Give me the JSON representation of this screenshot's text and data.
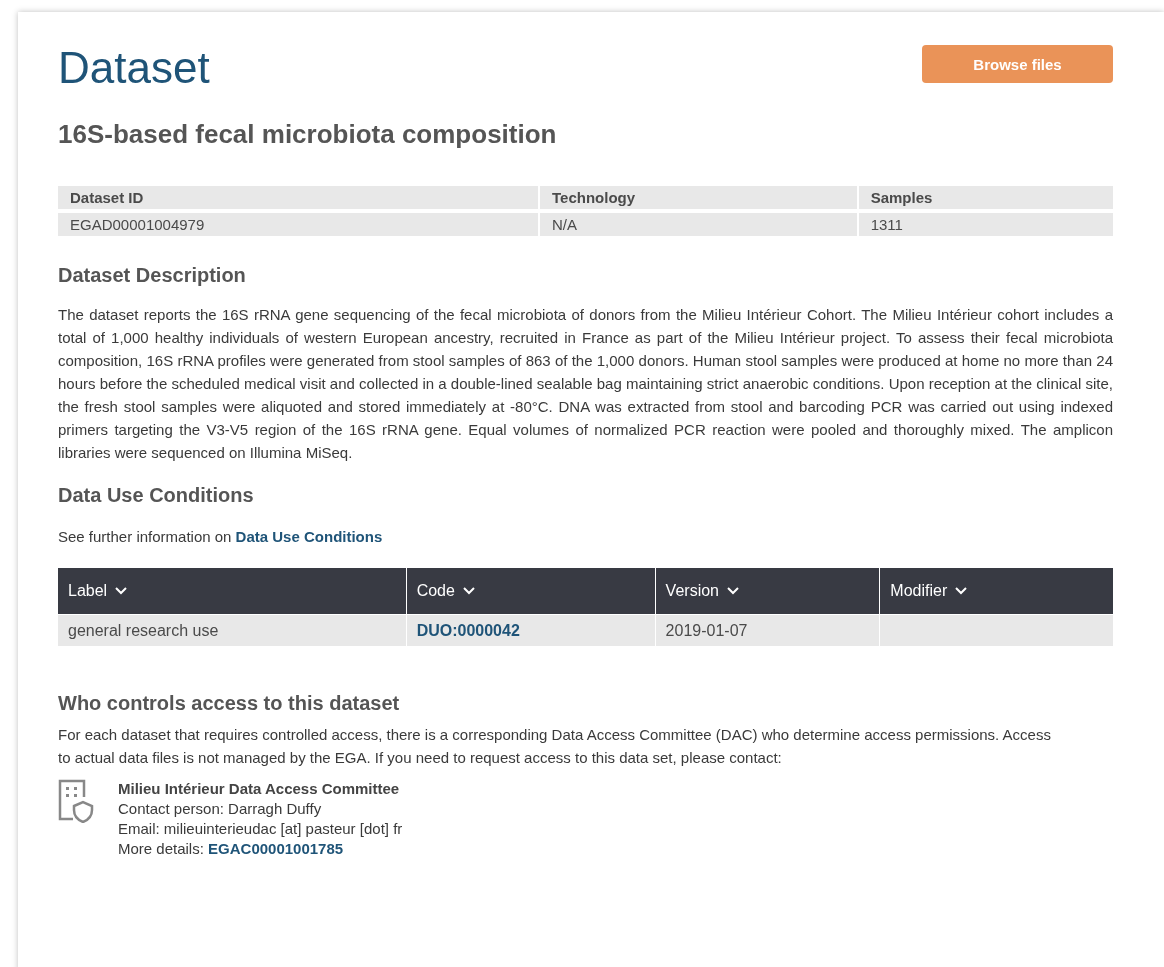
{
  "page_title": "Dataset",
  "browse_button": "Browse files",
  "dataset_title": "16S-based fecal microbiota composition",
  "summary_table": {
    "columns": [
      "Dataset ID",
      "Technology",
      "Samples"
    ],
    "rows": [
      [
        "EGAD00001004979",
        "N/A",
        "1311"
      ]
    ]
  },
  "description": {
    "heading": "Dataset Description",
    "text": "The dataset reports the 16S rRNA gene sequencing of the fecal microbiota of donors from the Milieu Intérieur Cohort. The Milieu Intérieur cohort includes a total of 1,000 healthy individuals of western European ancestry, recruited in France as part of the Milieu Intérieur project. To assess their fecal microbiota composition, 16S rRNA profiles were generated from stool samples of 863 of the 1,000 donors. Human stool samples were produced at home no more than 24 hours before the scheduled medical visit and collected in a double-lined sealable bag maintaining strict anaerobic conditions. Upon reception at the clinical site, the fresh stool samples were aliquoted and stored immediately at -80°C. DNA was extracted from stool and barcoding PCR was carried out using indexed primers targeting the V3-V5 region of the 16S rRNA gene. Equal volumes of normalized PCR reaction were pooled and thoroughly mixed. The amplicon libraries were sequenced on Illumina MiSeq."
  },
  "conditions": {
    "heading": "Data Use Conditions",
    "intro": "See further information on ",
    "intro_link": "Data Use Conditions",
    "columns": [
      "Label",
      "Code",
      "Version",
      "Modifier"
    ],
    "rows": [
      {
        "label": "general research use",
        "code": "DUO:0000042",
        "version": "2019-01-07"
      }
    ]
  },
  "access": {
    "heading": "Who controls access to this dataset",
    "text": "For each dataset that requires controlled access, there is a corresponding Data Access Committee (DAC) who determine access permissions. Access to actual data files is not managed by the EGA. If you need to request access to this data set, please contact:",
    "committee": "Milieu Intérieur Data Access Committee",
    "contact": "Contact person: Darragh Duffy",
    "email": "Email: milieuinterieudac [at] pasteur [dot] fr",
    "details_label": "More details: ",
    "details_link": "EGAC00001001785"
  }
}
